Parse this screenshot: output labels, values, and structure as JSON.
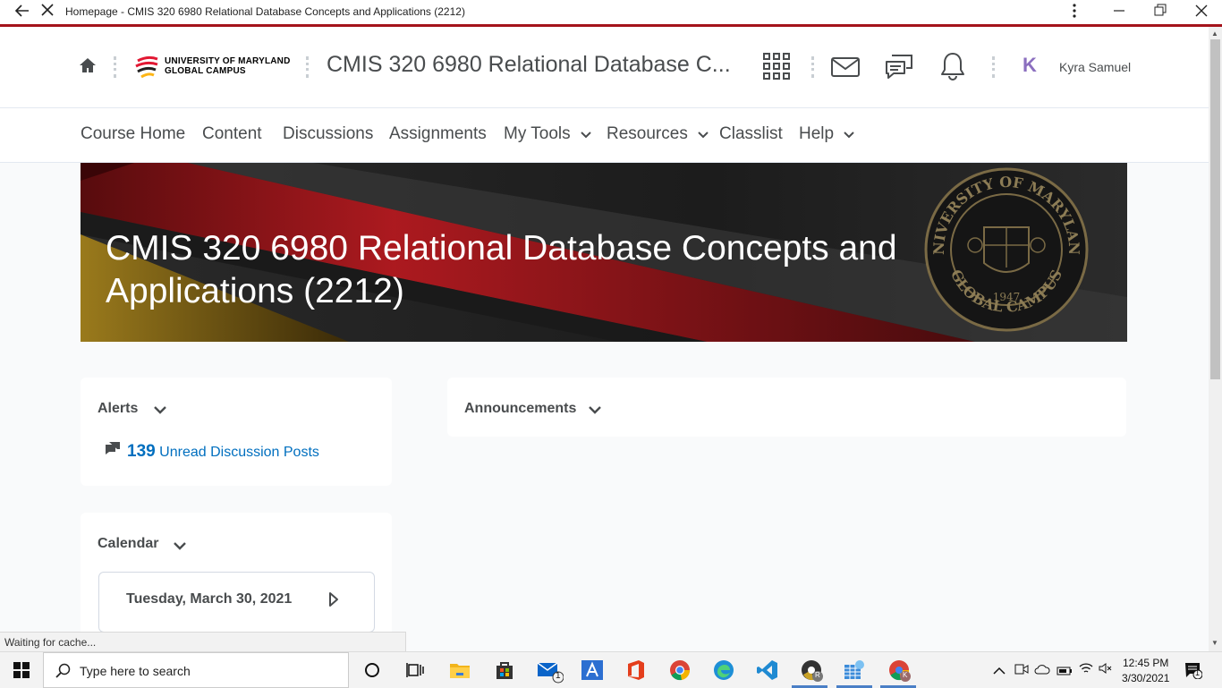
{
  "browser": {
    "tab_title": "Homepage - CMIS 320 6980 Relational Database Concepts and Applications (2212)"
  },
  "header": {
    "logo_line1": "UNIVERSITY OF MARYLAND",
    "logo_line2": "GLOBAL CAMPUS",
    "course_title": "CMIS 320 6980 Relational Database C...",
    "avatar_letter": "K",
    "user_name": "Kyra Samuel"
  },
  "nav": {
    "items": [
      {
        "label": "Course Home"
      },
      {
        "label": "Content"
      },
      {
        "label": "Discussions"
      },
      {
        "label": "Assignments"
      },
      {
        "label": "My Tools"
      },
      {
        "label": "Resources"
      },
      {
        "label": "Classlist"
      },
      {
        "label": "Help"
      }
    ]
  },
  "banner": {
    "title": "CMIS 320 6980 Relational Database Concepts and Applications (2212)",
    "seal_top": "UNIVERSITY OF MARYLAND",
    "seal_bottom": "GLOBAL CAMPUS",
    "seal_year": "1947"
  },
  "alerts": {
    "title": "Alerts",
    "count": "139",
    "link_text": "Unread Discussion Posts"
  },
  "announcements": {
    "title": "Announcements"
  },
  "calendar": {
    "title": "Calendar",
    "date": "Tuesday, March 30, 2021"
  },
  "status_bar": {
    "text": "Waiting for cache..."
  },
  "taskbar": {
    "search_placeholder": "Type here to search",
    "time": "12:45 PM",
    "date": "3/30/2021",
    "notification_count": "1",
    "mail_badge": "1",
    "app_badge_r": "R",
    "app_badge_k": "K"
  },
  "colors": {
    "accent_red": "#a4131b",
    "link_blue": "#006fbf",
    "avatar_purple": "#8b6fbf"
  }
}
